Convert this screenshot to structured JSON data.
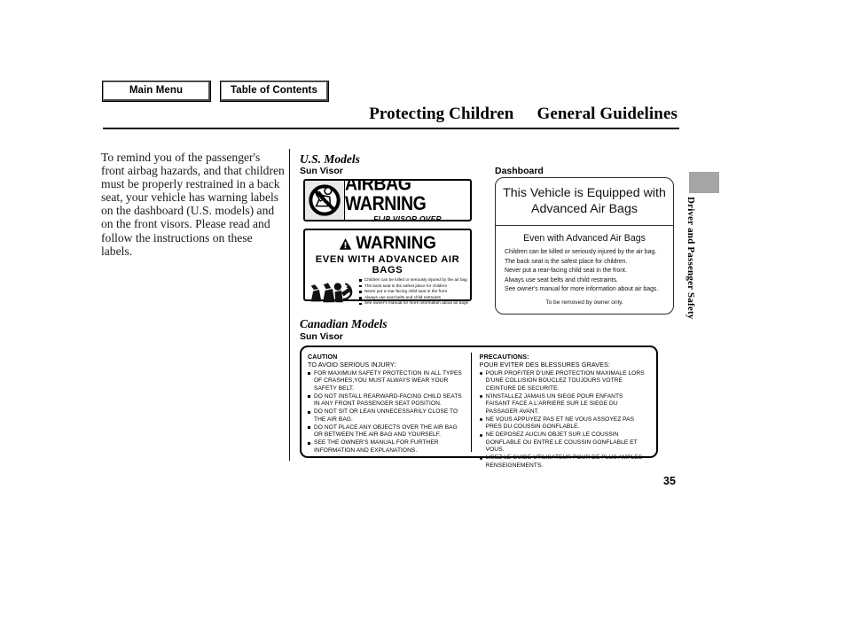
{
  "nav": {
    "main_menu": "Main Menu",
    "table_of_contents": "Table of Contents"
  },
  "header": {
    "title_left": "Protecting Children",
    "title_right": "General Guidelines"
  },
  "body_copy": "To remind you of the passenger's front airbag hazards, and that children must be properly restrained in a back seat, your vehicle has warning labels on the dashboard (U.S. models) and on the front visors. Please read and follow the instructions on these labels.",
  "sections": {
    "us_models": "U.S. Models",
    "us_sun_visor": "Sun Visor",
    "dashboard": "Dashboard",
    "canadian_models": "Canadian Models",
    "canadian_sun_visor": "Sun Visor"
  },
  "airbag_label": {
    "icon": "no-rear-facing-child-seat-icon",
    "headline": "AIRBAG WARNING",
    "subline": "FLIP VISOR OVER"
  },
  "warning_label": {
    "triangle_icon": "warning-triangle-icon",
    "headline": "WARNING",
    "subhead": "EVEN WITH ADVANCED AIR BAGS",
    "pictogram": "seat-airbag-child-icon",
    "bullets": [
      "Children can be killed or seriously injured by the air bag",
      "The back seat is the safest place for children",
      "Never put a rear-facing child seat in the front",
      "Always use seat belts and child restraints",
      "See owner's manual for more information about air bags"
    ]
  },
  "dashboard_label": {
    "title_line1": "This Vehicle is Equipped with",
    "title_line2": "Advanced Air Bags",
    "subhead": "Even with Advanced Air Bags",
    "lines": [
      "Children can be killed or seriously injured by the air bag.",
      "The back seat is the safest place for children.",
      "Never put a rear-facing child seat in the front.",
      "Always use seat belts and child restraints.",
      "See owner's manual for more information about air bags."
    ],
    "footer": "To be removed by owner only."
  },
  "canadian_label": {
    "english": {
      "title": "CAUTION",
      "subtitle": "TO AVOID SERIOUS INJURY:",
      "bullets": [
        "FOR MAXIMUM SAFETY PROTECTION IN ALL TYPES OF CRASHES,YOU MUST ALWAYS WEAR YOUR SAFETY BELT.",
        "DO NOT INSTALL REARWARD-FACING CHILD SEATS IN ANY FRONT PASSENGER SEAT POSITION.",
        "DO NOT SIT OR LEAN UNNECESSARILY CLOSE TO THE AIR BAG.",
        "DO NOT PLACE ANY OBJECTS OVER THE AIR BAG OR BETWEEN THE AIR BAG AND YOURSELF.",
        "SEE THE OWNER'S MANUAL FOR FURTHER INFORMATION AND EXPLANATIONS."
      ]
    },
    "french": {
      "title": "PRECAUTIONS:",
      "subtitle": "POUR EVITER DES BLESSURES GRAVES:",
      "bullets": [
        "POUR PROFITER D'UNE PROTECTION MAXIMALE LORS D'UNE COLLISION BOUCLEZ TOUJOURS VOTRE CEINTURE DE SECURITE.",
        "N'INSTALLEZ JAMAIS UN SIEGE POUR ENFANTS FAISANT FACE A L'ARRIERE SUR LE SIEGE DU PASSAGER AVANT.",
        "NE VOUS APPUYEZ PAS ET NE VOUS ASSOYEZ PAS PRES DU COUSSIN GONFLABLE.",
        "NE DEPOSEZ AUCUN OBJET SUR LE COUSSIN GONFLABLE OU ENTRE LE COUSSIN GONFLABLE ET VOUS.",
        "LISEZ LE GUIDE UTILISATEUR POUR DE PLUS AMPLES RENSEIGNEMENTS."
      ]
    }
  },
  "edge_tab": {
    "label": "Driver and Passenger Safety",
    "color": "#a5a5a5"
  },
  "page_number": "35"
}
